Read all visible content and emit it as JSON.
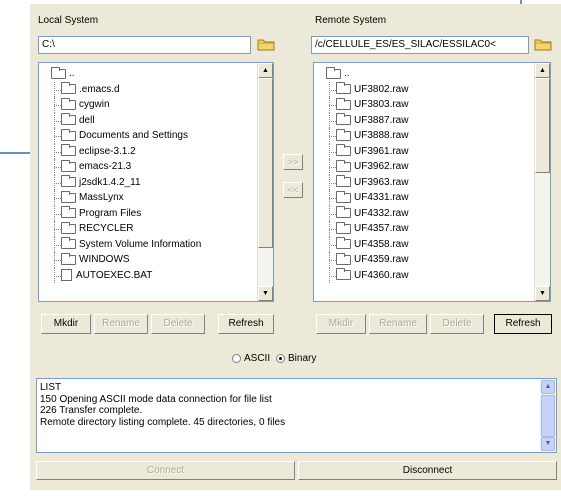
{
  "local": {
    "label": "Local System",
    "path": "C:\\",
    "items": [
      {
        "name": "..",
        "type": "folder"
      },
      {
        "name": ".emacs.d",
        "type": "folder"
      },
      {
        "name": "cygwin",
        "type": "folder"
      },
      {
        "name": "dell",
        "type": "folder"
      },
      {
        "name": "Documents and Settings",
        "type": "folder"
      },
      {
        "name": "eclipse-3.1.2",
        "type": "folder"
      },
      {
        "name": "emacs-21.3",
        "type": "folder"
      },
      {
        "name": "j2sdk1.4.2_11",
        "type": "folder"
      },
      {
        "name": "MassLynx",
        "type": "folder"
      },
      {
        "name": "Program Files",
        "type": "folder"
      },
      {
        "name": "RECYCLER",
        "type": "folder"
      },
      {
        "name": "System Volume Information",
        "type": "folder"
      },
      {
        "name": "WINDOWS",
        "type": "folder"
      },
      {
        "name": "AUTOEXEC.BAT",
        "type": "file"
      }
    ],
    "buttons": {
      "mkdir": "Mkdir",
      "rename": "Rename",
      "delete": "Delete",
      "refresh": "Refresh"
    }
  },
  "remote": {
    "label": "Remote System",
    "path": "/c/CELLULE_ES/ES_SILAC/ESSILAC0<",
    "items": [
      {
        "name": "..",
        "type": "folder"
      },
      {
        "name": "UF3802.raw",
        "type": "folder"
      },
      {
        "name": "UF3803.raw",
        "type": "folder"
      },
      {
        "name": "UF3887.raw",
        "type": "folder"
      },
      {
        "name": "UF3888.raw",
        "type": "folder"
      },
      {
        "name": "UF3961.raw",
        "type": "folder"
      },
      {
        "name": "UF3962.raw",
        "type": "folder"
      },
      {
        "name": "UF3963.raw",
        "type": "folder"
      },
      {
        "name": "UF4331.raw",
        "type": "folder"
      },
      {
        "name": "UF4332.raw",
        "type": "folder"
      },
      {
        "name": "UF4357.raw",
        "type": "folder"
      },
      {
        "name": "UF4358.raw",
        "type": "folder"
      },
      {
        "name": "UF4359.raw",
        "type": "folder"
      },
      {
        "name": "UF4360.raw",
        "type": "folder"
      }
    ],
    "buttons": {
      "mkdir": "Mkdir",
      "rename": "Rename",
      "delete": "Delete",
      "refresh": "Refresh"
    }
  },
  "transfer": {
    "upload_label": ">>",
    "download_label": "<<"
  },
  "mode": {
    "ascii": "ASCII",
    "binary": "Binary",
    "selected": "binary"
  },
  "log": {
    "lines": [
      "LIST",
      "150 Opening ASCII mode data connection for file list",
      "226 Transfer complete.",
      "Remote directory listing complete. 45 directories, 0 files"
    ]
  },
  "connection": {
    "connect_label": "Connect",
    "disconnect_label": "Disconnect"
  }
}
